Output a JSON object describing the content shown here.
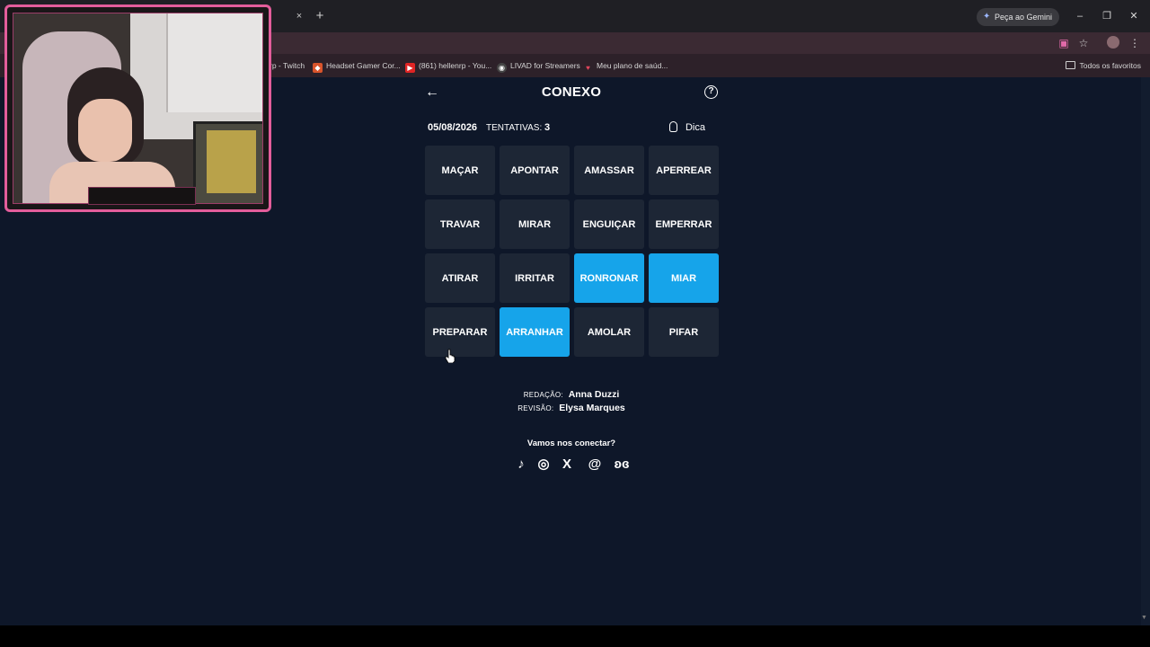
{
  "browser": {
    "tab_close": "×",
    "new_tab": "+",
    "gemini_label": "Peça ao Gemini",
    "window_controls": {
      "minimize": "–",
      "maximize": "❐",
      "close": "✕"
    },
    "bookmarks": [
      {
        "label": "rp - Twitch",
        "icon": "twitch-icon"
      },
      {
        "label": "Headset Gamer Cor...",
        "icon": "shop-icon"
      },
      {
        "label": "(861) hellenrp - You...",
        "icon": "youtube-icon"
      },
      {
        "label": "LIVAD for Streamers",
        "icon": "livad-icon"
      },
      {
        "label": "Meu plano de saúd...",
        "icon": "heart-icon"
      }
    ],
    "all_favorites": "Todos os favoritos"
  },
  "game": {
    "title": "CONEXO",
    "date": "05/08/2026",
    "tries_label": "TENTATIVAS:",
    "tries_value": "3",
    "hint_label": "Dica",
    "help_symbol": "?",
    "back_symbol": "←",
    "tiles": [
      {
        "word": "MAÇAR",
        "selected": false
      },
      {
        "word": "APONTAR",
        "selected": false
      },
      {
        "word": "AMASSAR",
        "selected": false
      },
      {
        "word": "APERREAR",
        "selected": false
      },
      {
        "word": "TRAVAR",
        "selected": false
      },
      {
        "word": "MIRAR",
        "selected": false
      },
      {
        "word": "ENGUIÇAR",
        "selected": false
      },
      {
        "word": "EMPERRAR",
        "selected": false
      },
      {
        "word": "ATIRAR",
        "selected": false
      },
      {
        "word": "IRRITAR",
        "selected": false
      },
      {
        "word": "RONRONAR",
        "selected": true
      },
      {
        "word": "MIAR",
        "selected": true
      },
      {
        "word": "PREPARAR",
        "selected": false
      },
      {
        "word": "ARRANHAR",
        "selected": true
      },
      {
        "word": "AMOLAR",
        "selected": false
      },
      {
        "word": "PIFAR",
        "selected": false
      }
    ],
    "credits": {
      "redacao_role": "REDAÇÃO:",
      "redacao_name": "Anna Duzzi",
      "revisao_role": "REVISÃO:",
      "revisao_name": "Elysa Marques"
    },
    "connect_label": "Vamos nos conectar?",
    "socials": [
      {
        "name": "tiktok-icon",
        "glyph": "♪"
      },
      {
        "name": "instagram-icon",
        "glyph": "◎"
      },
      {
        "name": "x-icon",
        "glyph": "X"
      },
      {
        "name": "threads-icon",
        "glyph": "@"
      },
      {
        "name": "bluesky-icon",
        "glyph": "ʚɞ"
      }
    ]
  },
  "colors": {
    "page_bg": "#0e1729",
    "tile_bg": "#1d2635",
    "tile_selected": "#16a4ea",
    "webcam_border": "#e35d9b"
  }
}
